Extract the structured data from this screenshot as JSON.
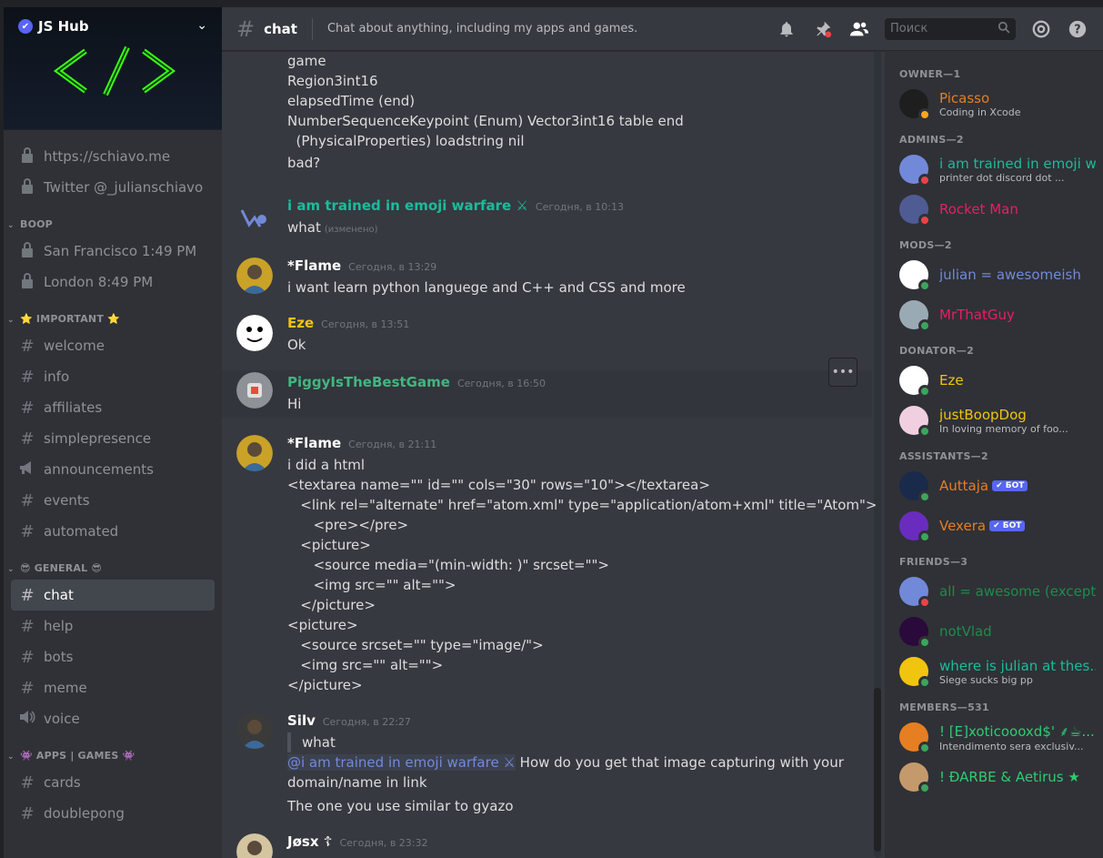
{
  "server": {
    "name": "JS Hub",
    "logo_text": "</>"
  },
  "sidebar": {
    "links": [
      {
        "label": "https://schiavo.me"
      },
      {
        "label": "Twitter @_julianschiavo"
      }
    ],
    "categories": [
      {
        "name": "BOOP",
        "channels": [
          {
            "label": "San Francisco 1:49 PM",
            "icon": "lock-icon"
          },
          {
            "label": "London 8:49 PM",
            "icon": "lock-icon"
          }
        ]
      },
      {
        "name": "⭐ IMPORTANT ⭐",
        "channels": [
          {
            "label": "welcome"
          },
          {
            "label": "info"
          },
          {
            "label": "affiliates"
          },
          {
            "label": "simplepresence"
          },
          {
            "label": "announcements",
            "icon": "megaphone-icon"
          },
          {
            "label": "events"
          },
          {
            "label": "automated"
          }
        ]
      },
      {
        "name": "😎 GENERAL 😎",
        "channels": [
          {
            "label": "chat",
            "active": true
          },
          {
            "label": "help"
          },
          {
            "label": "bots"
          },
          {
            "label": "meme"
          },
          {
            "label": "voice",
            "icon": "speaker-icon"
          }
        ]
      },
      {
        "name": "👾 APPS | GAMES 👾",
        "channels": [
          {
            "label": "cards"
          },
          {
            "label": "doublepong"
          }
        ]
      }
    ]
  },
  "header": {
    "channel": "chat",
    "topic": "Chat about anything, including my apps and games.",
    "search_placeholder": "Поиск"
  },
  "chat": {
    "continued_lines": [
      "game",
      "Region3int16",
      "elapsedTime (end)",
      "NumberSequenceKeypoint (Enum) Vector3int16 table end",
      "  (PhysicalProperties) loadstring nil",
      "bad?"
    ],
    "messages": [
      {
        "author": "i am trained in emoji warfare ⚔",
        "color": "#1abc9c",
        "time": "Сегодня, в 10:13",
        "lines": [
          "what"
        ],
        "edited": "(изменено)"
      },
      {
        "author": "*Flame",
        "color": "#ffffff",
        "time": "Сегодня, в 13:29",
        "lines": [
          "i want learn python languege and C++ and CSS and more"
        ]
      },
      {
        "author": "Eze",
        "color": "#f1c40f",
        "time": "Сегодня, в 13:51",
        "lines": [
          "Ok"
        ]
      },
      {
        "author": "PiggyIsTheBestGame",
        "color": "#43b581",
        "time": "Сегодня, в 16:50",
        "lines": [
          "Hi"
        ]
      },
      {
        "author": "*Flame",
        "color": "#ffffff",
        "time": "Сегодня, в 21:11",
        "lines": [
          "i did a html",
          "<textarea name=\"\" id=\"\" cols=\"30\" rows=\"10\"></textarea>",
          "   <link rel=\"alternate\" href=\"atom.xml\" type=\"application/atom+xml\" title=\"Atom\">",
          "      <pre></pre>",
          "   <picture>",
          "      <source media=\"(min-width: )\" srcset=\"\">",
          "      <img src=\"\" alt=\"\">",
          "   </picture>",
          "<picture>",
          "   <source srcset=\"\" type=\"image/\">",
          "   <img src=\"\" alt=\"\">",
          "</picture>"
        ]
      },
      {
        "author": "Silv",
        "color": "#ffffff",
        "time": "Сегодня, в 22:27",
        "quote": "what",
        "mention": "@i am trained in emoji warfare ⚔",
        "mention_text": " How do you get that image capturing with your",
        "lines": [
          "domain/name in link",
          "The one you use similar to gyazo"
        ]
      },
      {
        "author": "Jøsx ☦",
        "color": "#ffffff",
        "time": "Сегодня, в 23:32",
        "lines": []
      }
    ]
  },
  "members": {
    "groups": [
      {
        "title": "OWNER—1",
        "items": [
          {
            "name": "Picasso",
            "color": "#e67e22",
            "status": "idle",
            "activity": "Coding in Xcode"
          }
        ]
      },
      {
        "title": "ADMINS—2",
        "items": [
          {
            "name": "i am trained in emoji w...",
            "color": "#1abc9c",
            "status": "dnd",
            "activity": "printer dot discord dot ..."
          },
          {
            "name": "Rocket Man",
            "color": "#e91e63",
            "status": "dnd",
            "activity": ""
          }
        ]
      },
      {
        "title": "MODS—2",
        "items": [
          {
            "name": "julian = awesomeish",
            "color": "#7289da",
            "status": "online",
            "activity": ""
          },
          {
            "name": "MrThatGuy",
            "color": "#e91e63",
            "status": "online",
            "activity": ""
          }
        ]
      },
      {
        "title": "DONATOR—2",
        "items": [
          {
            "name": "Eze",
            "color": "#f1c40f",
            "status": "online",
            "activity": ""
          },
          {
            "name": "justBoopDog",
            "color": "#f1c40f",
            "status": "online",
            "activity": "In loving memory of foo..."
          }
        ]
      },
      {
        "title": "ASSISTANTS—2",
        "items": [
          {
            "name": "Auttaja",
            "color": "#e67e22",
            "status": "online",
            "activity": "",
            "bot": "✔ БОТ"
          },
          {
            "name": "Vexera",
            "color": "#e67e22",
            "status": "online",
            "activity": "",
            "bot": "✔ БОТ"
          }
        ]
      },
      {
        "title": "FRIENDS—3",
        "items": [
          {
            "name": "all = awesome (except...",
            "color": "#1f8b4c",
            "status": "dnd",
            "activity": ""
          },
          {
            "name": "notVlad",
            "color": "#1f8b4c",
            "status": "online",
            "activity": ""
          },
          {
            "name": "where is julian at thes...",
            "color": "#1abc9c",
            "status": "online",
            "activity": "Siege sucks big pp"
          }
        ]
      },
      {
        "title": "MEMBERS—531",
        "items": [
          {
            "name": "! [E]xoticoooxd$' ⸙☕...",
            "color": "#2ecc71",
            "status": "online",
            "activity": "Intendimento sera exclusiv..."
          },
          {
            "name": "! ĐARBE & Aetirus ★",
            "color": "#2ecc71",
            "status": "online",
            "activity": ""
          }
        ]
      }
    ]
  },
  "colors": {
    "sidebar": "#2f3136",
    "main": "#36393f",
    "accent": "#5865f2"
  }
}
